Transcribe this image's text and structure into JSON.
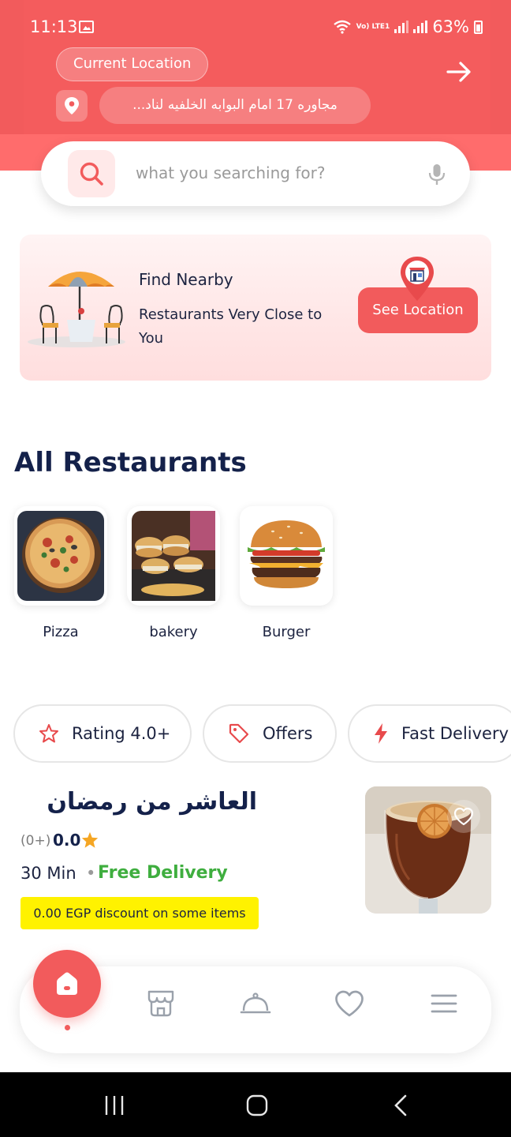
{
  "status_bar": {
    "time": "11:13",
    "network": "Vo) LTE1",
    "battery": "63%"
  },
  "header": {
    "location_label": "Current Location",
    "address": "مجاوره 17 امام البوابه الخلفيه لناد...",
    "icons": {
      "arrow": "arrow-right-icon",
      "pin": "location-pin-icon"
    }
  },
  "search": {
    "placeholder": "what you searching for?",
    "icons": {
      "search": "search-icon",
      "mic": "microphone-icon"
    }
  },
  "nearby_card": {
    "title": "Find Nearby",
    "subtitle": "Restaurants Very Close to You",
    "button_label": "See Location"
  },
  "restaurants_section": {
    "title": "All Restaurants"
  },
  "categories": [
    {
      "label": "Pizza",
      "icon": "pizza-image"
    },
    {
      "label": "bakery",
      "icon": "bakery-image"
    },
    {
      "label": "Burger",
      "icon": "burger-image"
    }
  ],
  "filters": [
    {
      "label": "Rating 4.0+",
      "icon": "star-outline-icon"
    },
    {
      "label": "Offers",
      "icon": "tag-icon"
    },
    {
      "label": "Fast Delivery",
      "icon": "lightning-icon"
    }
  ],
  "restaurant": {
    "name": "العاشر من رمضان",
    "rating_count": "(0+)",
    "rating": "0.0",
    "time": "30 Min",
    "delivery": "Free Delivery",
    "discount": "0.00 EGP discount on some items"
  },
  "bottom_nav": {
    "items": [
      {
        "name": "home",
        "icon": "home-icon",
        "active": true
      },
      {
        "name": "stores",
        "icon": "store-icon",
        "active": false
      },
      {
        "name": "orders",
        "icon": "cloche-icon",
        "active": false
      },
      {
        "name": "favorites",
        "icon": "heart-icon",
        "active": false
      },
      {
        "name": "menu",
        "icon": "menu-icon",
        "active": false
      }
    ]
  },
  "colors": {
    "accent": "#f25b5c",
    "title": "#14214a",
    "delivery_green": "#3fae3f",
    "discount_yellow": "#fff200"
  }
}
